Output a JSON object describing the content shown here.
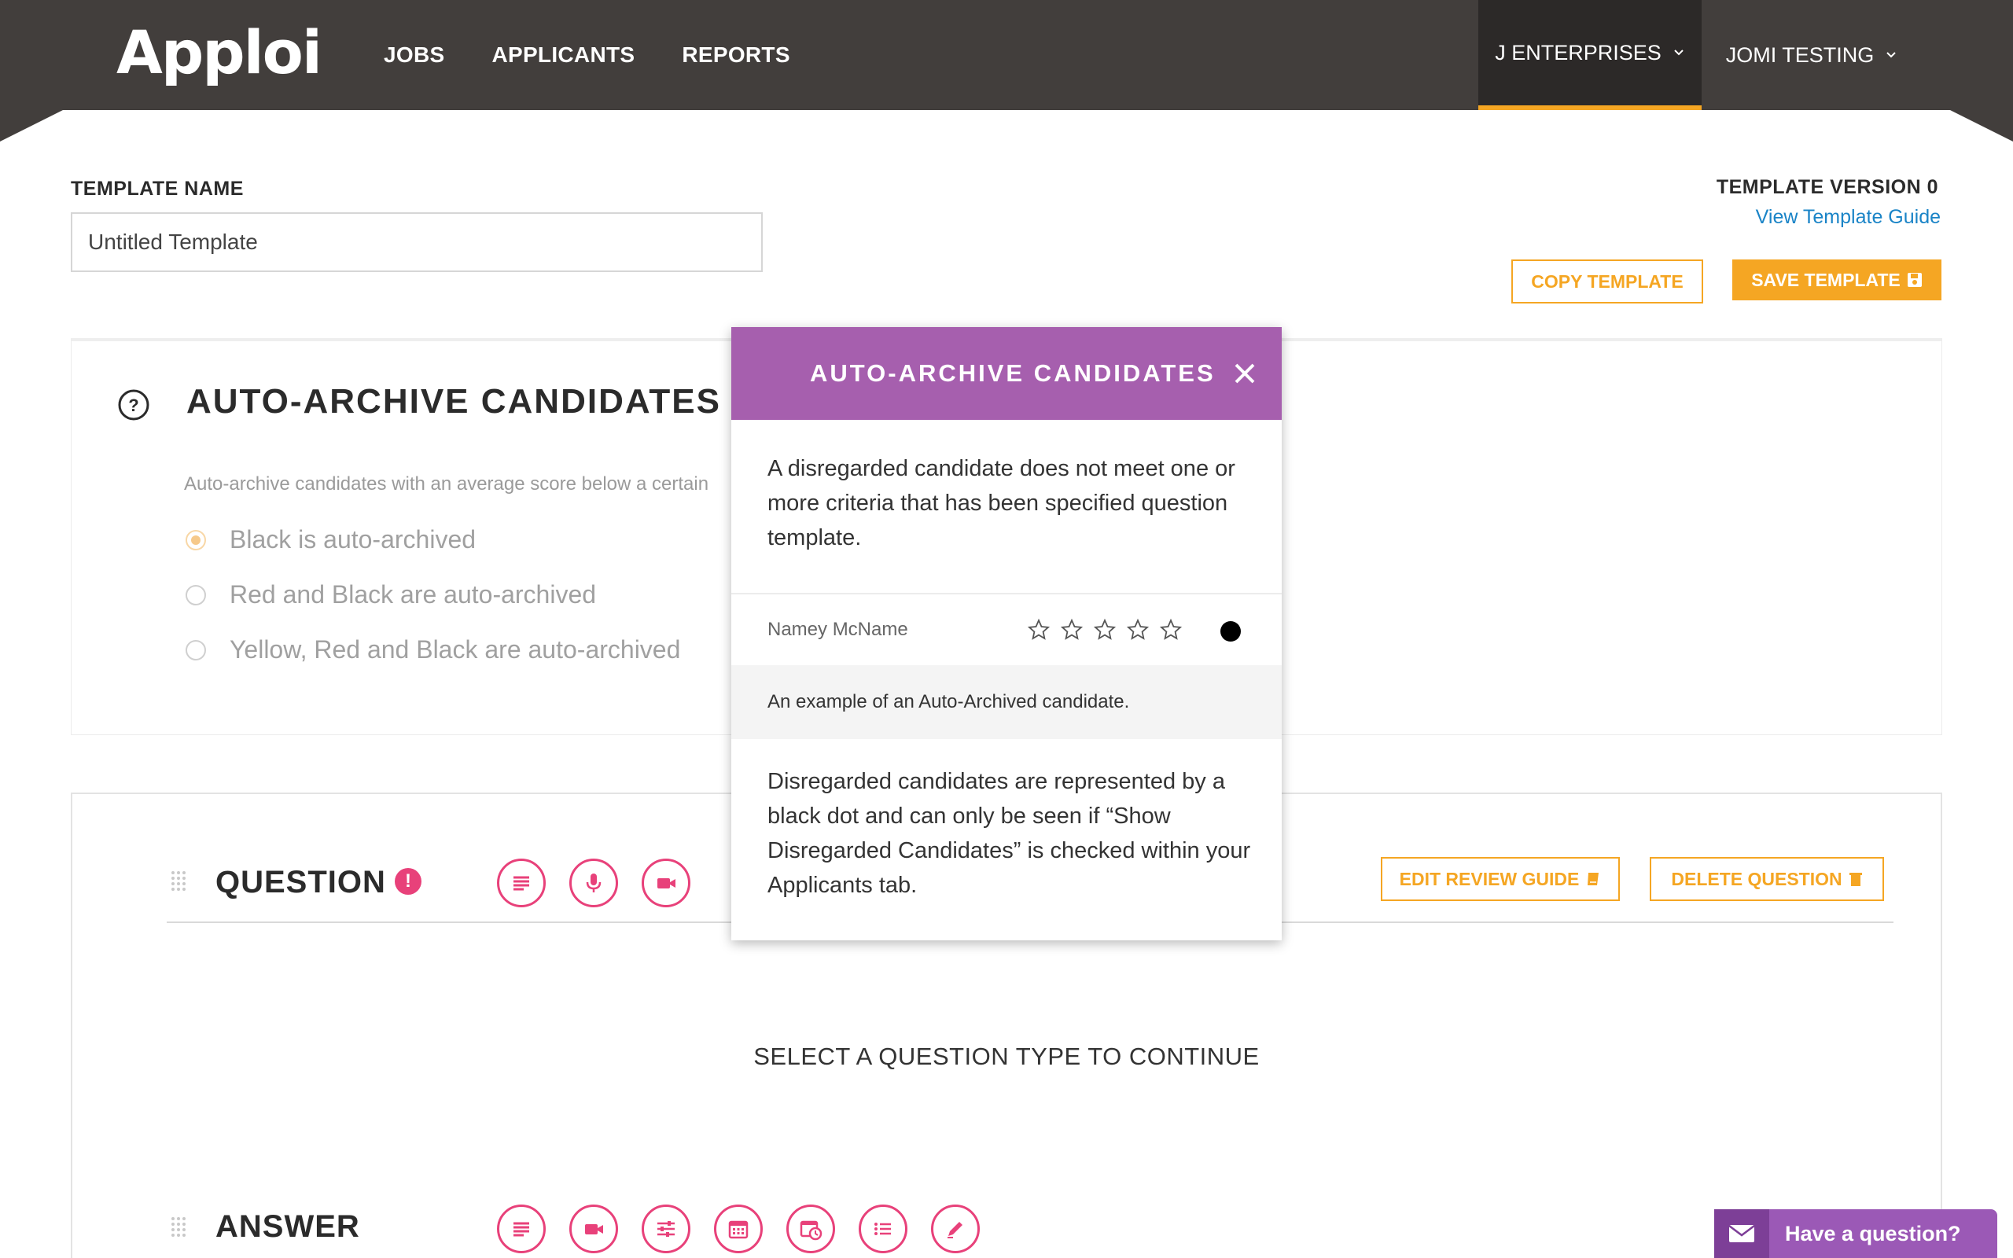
{
  "header": {
    "logo": "Apploi",
    "nav": [
      "JOBS",
      "APPLICANTS",
      "REPORTS"
    ],
    "org_primary": "J ENTERPRISES",
    "org_secondary": "JOMI TESTING"
  },
  "template": {
    "name_label": "TEMPLATE NAME",
    "name_value": "Untitled Template",
    "version_label": "TEMPLATE VERSION 0",
    "guide_link": "View Template Guide",
    "copy_button": "COPY TEMPLATE",
    "save_button": "SAVE TEMPLATE"
  },
  "auto_archive": {
    "title": "AUTO-ARCHIVE CANDIDATES",
    "description": "Auto-archive candidates with an average score below a certain",
    "options": [
      {
        "label": "Black is auto-archived",
        "selected": true
      },
      {
        "label": "Red and Black are auto-archived",
        "selected": false
      },
      {
        "label": "Yellow, Red and Black are auto-archived",
        "selected": false
      }
    ]
  },
  "question": {
    "title": "QUESTION",
    "alert": "!",
    "edit_guide_button": "EDIT REVIEW GUIDE",
    "delete_button": "DELETE QUESTION",
    "prompt": "SELECT A QUESTION TYPE TO CONTINUE",
    "answer_title": "ANSWER",
    "accent": "#e8417a"
  },
  "modal": {
    "title": "AUTO-ARCHIVE CANDIDATES",
    "paragraph1": "A disregarded candidate does not meet one or more criteria that has been specified question template.",
    "example_name": "Namey McName",
    "example_caption": "An example of an Auto-Archived candidate.",
    "paragraph2": "Disregarded candidates are represented by a black dot and can only be seen if “Show Disregarded Candidates” is checked within your Applicants tab.",
    "rating_stars": 5,
    "header_color": "#a65fae"
  },
  "chat": {
    "label": "Have a question?"
  },
  "colors": {
    "topbar": "#423e3c",
    "accent_orange": "#f5a623",
    "link_blue": "#1a84c7"
  }
}
